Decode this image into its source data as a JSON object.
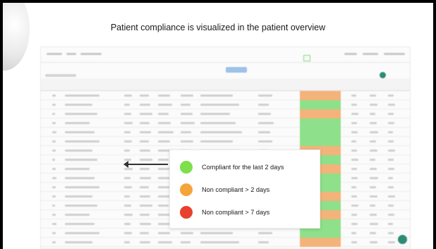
{
  "slide": {
    "title": "Patient compliance is visualized in the patient overview"
  },
  "legend": {
    "items": [
      {
        "label": "Compliant for the last 2 days",
        "color": "#7ddf4a"
      },
      {
        "label": "Non compliant > 2 days",
        "color": "#f5a43a"
      },
      {
        "label": "Non compliant > 7 days",
        "color": "#e8412f"
      }
    ]
  },
  "colors": {
    "compliant": "#7ddf4a",
    "non_compliant_2": "#f5a43a",
    "non_compliant_7": "#e8412f",
    "status_green_cell": "#8ee08a",
    "status_orange_cell": "#f4b37a",
    "accent": "#2e8b73"
  },
  "status_rows": [
    "orange",
    "green",
    "orange",
    "green",
    "green",
    "green",
    "orange",
    "green",
    "orange",
    "green",
    "green",
    "orange",
    "green",
    "orange",
    "green",
    "green",
    "orange"
  ]
}
